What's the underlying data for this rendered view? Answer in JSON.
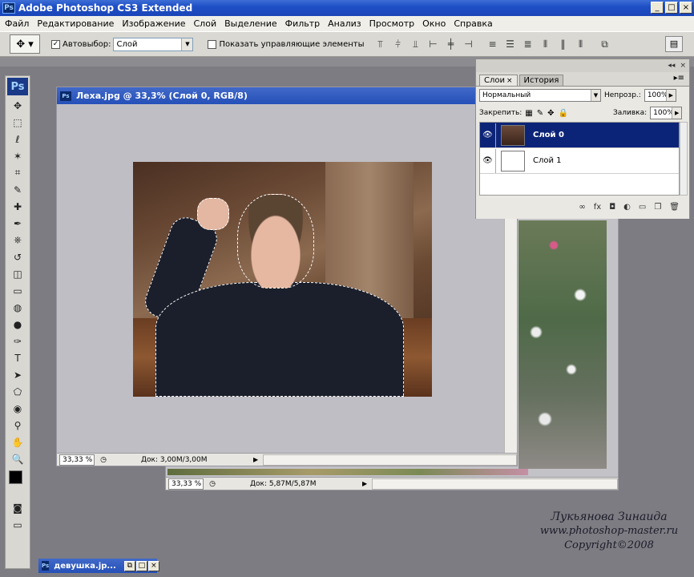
{
  "app": {
    "title": "Adobe Photoshop CS3 Extended",
    "icon_text": "Ps"
  },
  "window_buttons": [
    "_",
    "□",
    "×"
  ],
  "menu": [
    "Файл",
    "Редактирование",
    "Изображение",
    "Слой",
    "Выделение",
    "Фильтр",
    "Анализ",
    "Просмотр",
    "Окно",
    "Справка"
  ],
  "options": {
    "autoselect_label": "Автовыбор:",
    "autoselect_value": "Слой",
    "show_controls_label": "Показать управляющие элементы"
  },
  "toolbox": {
    "logo": "Ps",
    "tools": [
      "move-tool",
      "marquee-tool",
      "lasso-tool",
      "magic-wand-tool",
      "crop-tool",
      "slice-tool",
      "healing-tool",
      "brush-tool",
      "stamp-tool",
      "history-brush-tool",
      "eraser-tool",
      "gradient-tool",
      "blur-tool",
      "dodge-tool",
      "pen-tool",
      "type-tool",
      "path-select-tool",
      "shape-tool",
      "notes-tool",
      "eyedropper-tool",
      "hand-tool",
      "zoom-tool"
    ],
    "tool_glyphs": [
      "✥",
      "⬚",
      "ℓ",
      "✶",
      "⌗",
      "✎",
      "✚",
      "✒",
      "⎈",
      "↺",
      "◫",
      "▭",
      "◍",
      "●",
      "✑",
      "T",
      "➤",
      "⬠",
      "◉",
      "⚲",
      "✋",
      "🔍"
    ]
  },
  "document_front": {
    "title": "Леха.jpg @ 33,3% (Слой 0, RGB/8)",
    "zoom": "33,33 %",
    "doc_size": "Док: 3,00M/3,00M"
  },
  "document_back": {
    "zoom": "33,33 %",
    "doc_size": "Док: 5,87M/5,87M"
  },
  "layers_panel": {
    "tabs": [
      "Слои",
      "История"
    ],
    "blend_mode": "Нормальный",
    "opacity_label": "Непрозр.:",
    "opacity_value": "100%",
    "lock_label": "Закрепить:",
    "fill_label": "Заливка:",
    "fill_value": "100%",
    "layers": [
      {
        "name": "Слой 0",
        "selected": true
      },
      {
        "name": "Слой 1",
        "selected": false
      }
    ]
  },
  "minimized_doc": {
    "title": "девушка.jp..."
  },
  "watermark": {
    "line1": "Лукьянова Зинаида",
    "line2": "www.photoshop-master.ru",
    "line3": "Copyright©2008"
  }
}
